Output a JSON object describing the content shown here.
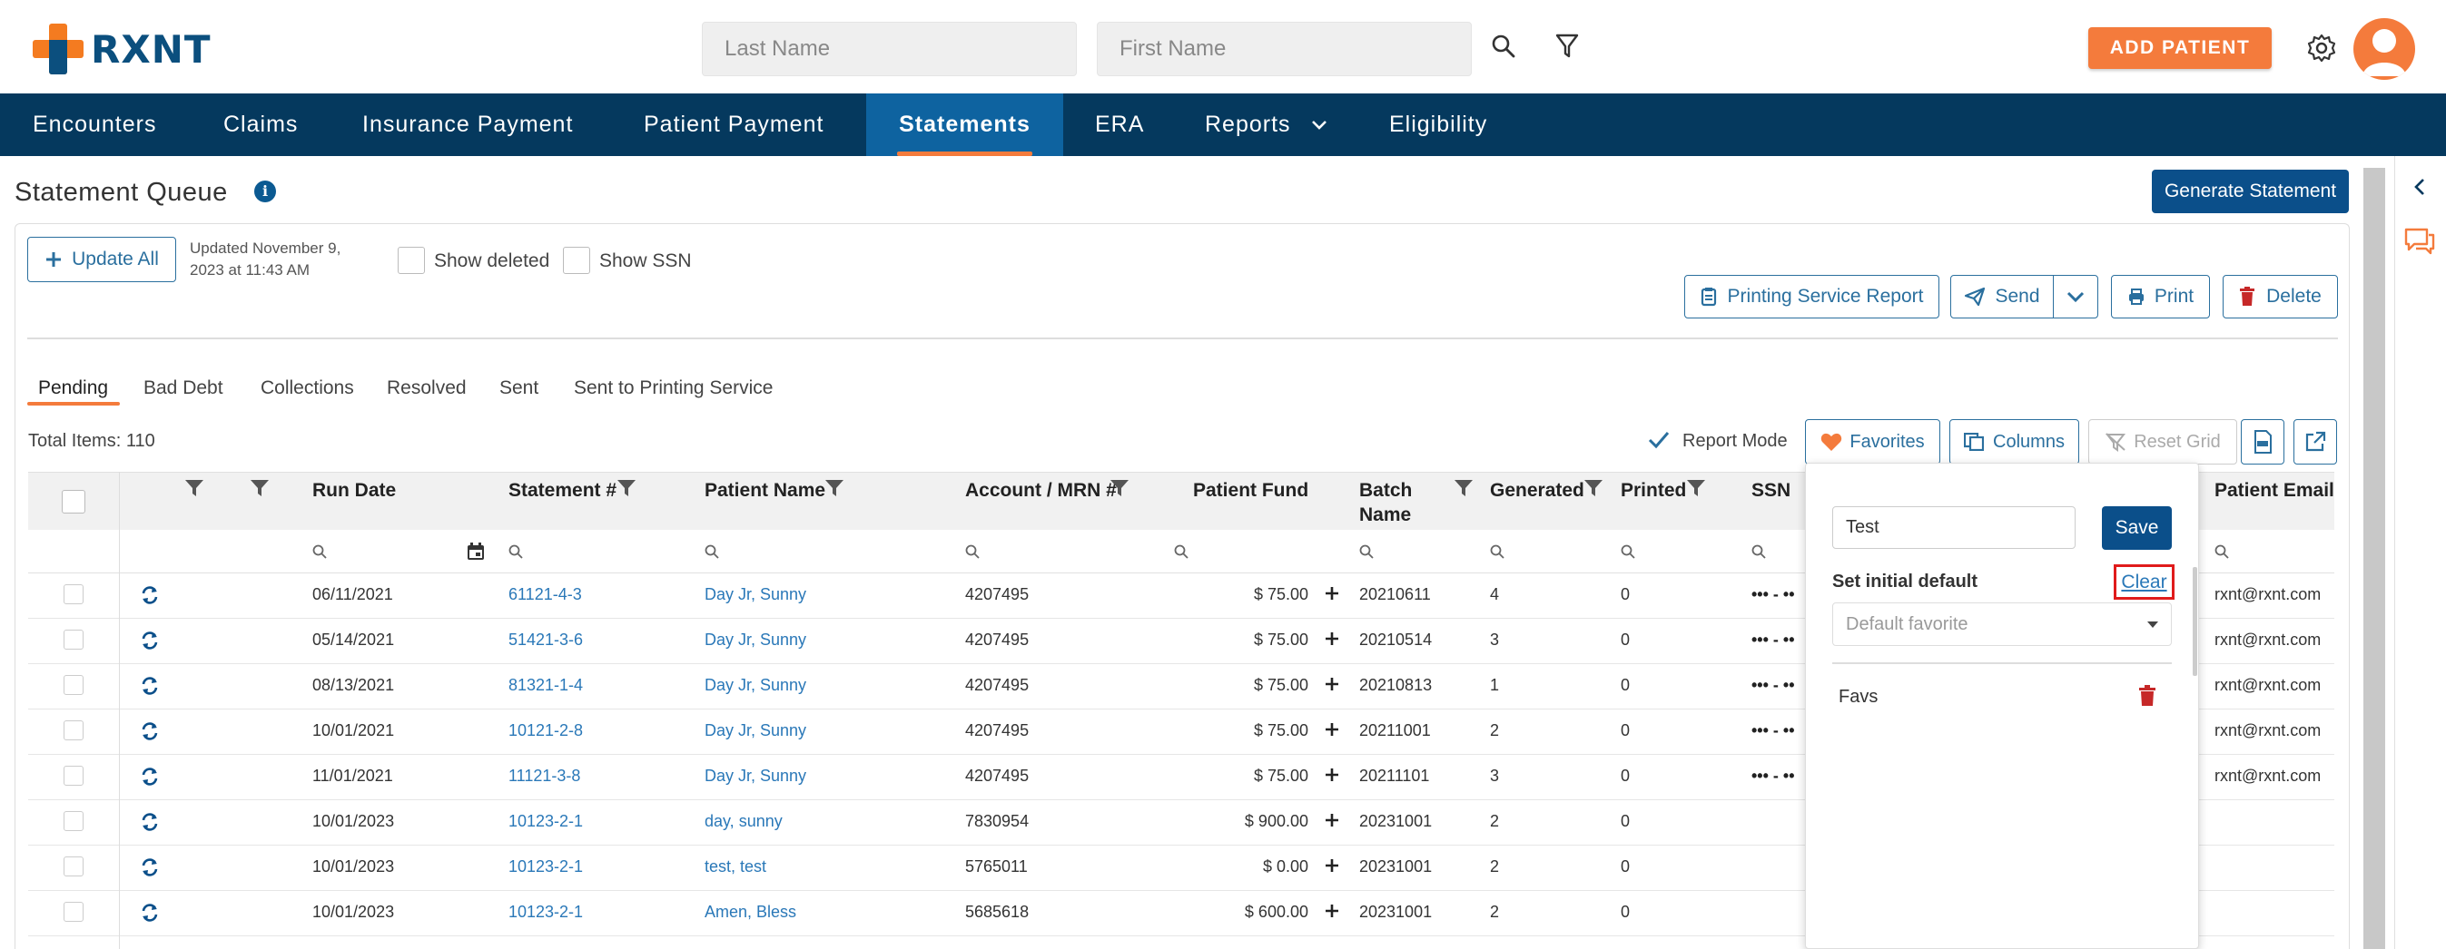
{
  "brand": {
    "name": "RXNT",
    "orange": "#f47b20",
    "navy": "#0b4f7e"
  },
  "header": {
    "last_name_placeholder": "Last Name",
    "first_name_placeholder": "First Name",
    "search_icon": "search-icon",
    "filter_icon": "filter-icon",
    "add_patient_label": "ADD PATIENT",
    "settings_icon": "gear-icon"
  },
  "nav": {
    "items": [
      "Encounters",
      "Claims",
      "Insurance Payment",
      "Patient Payment",
      "Statements",
      "ERA",
      "Reports",
      "Eligibility"
    ],
    "active": "Statements"
  },
  "page": {
    "title": "Statement Queue",
    "info_glyph": "i",
    "generate_label": "Generate Statement"
  },
  "toolbar": {
    "update_all_label": "Update All",
    "updated_line1": "Updated November 9,",
    "updated_line2": "2023 at 11:43 AM",
    "show_deleted_label": "Show deleted",
    "show_ssn_label": "Show SSN",
    "printing_service_report_label": "Printing Service Report",
    "send_label": "Send",
    "print_label": "Print",
    "delete_label": "Delete"
  },
  "tabs": [
    "Pending",
    "Bad Debt",
    "Collections",
    "Resolved",
    "Sent",
    "Sent to Printing Service"
  ],
  "grid": {
    "total_items": "Total Items: 110",
    "report_mode_label": "Report Mode",
    "favorites_label": "Favorites",
    "columns_label": "Columns",
    "reset_grid_label": "Reset Grid",
    "columns": {
      "run_date": "Run Date",
      "statement": "Statement #",
      "patient_name": "Patient Name",
      "account": "Account / MRN #",
      "patient_fund": "Patient Fund",
      "batch_name_1": "Batch",
      "batch_name_2": "Name",
      "generated": "Generated",
      "printed": "Printed",
      "ssn": "SSN",
      "patient_email": "Patient Email"
    },
    "rows": [
      {
        "run_date": "06/11/2021",
        "statement": "61121-4-3",
        "patient": "Day Jr, Sunny",
        "account": "4207495",
        "fund": "$ 75.00",
        "batch": "20210611",
        "generated": "4",
        "printed": "0",
        "ssn": "••• - ••",
        "email": "rxnt@rxnt.com"
      },
      {
        "run_date": "05/14/2021",
        "statement": "51421-3-6",
        "patient": "Day Jr, Sunny",
        "account": "4207495",
        "fund": "$ 75.00",
        "batch": "20210514",
        "generated": "3",
        "printed": "0",
        "ssn": "••• - ••",
        "email": "rxnt@rxnt.com"
      },
      {
        "run_date": "08/13/2021",
        "statement": "81321-1-4",
        "patient": "Day Jr, Sunny",
        "account": "4207495",
        "fund": "$ 75.00",
        "batch": "20210813",
        "generated": "1",
        "printed": "0",
        "ssn": "••• - ••",
        "email": "rxnt@rxnt.com"
      },
      {
        "run_date": "10/01/2021",
        "statement": "10121-2-8",
        "patient": "Day Jr, Sunny",
        "account": "4207495",
        "fund": "$ 75.00",
        "batch": "20211001",
        "generated": "2",
        "printed": "0",
        "ssn": "••• - ••",
        "email": "rxnt@rxnt.com"
      },
      {
        "run_date": "11/01/2021",
        "statement": "11121-3-8",
        "patient": "Day Jr, Sunny",
        "account": "4207495",
        "fund": "$ 75.00",
        "batch": "20211101",
        "generated": "3",
        "printed": "0",
        "ssn": "••• - ••",
        "email": "rxnt@rxnt.com"
      },
      {
        "run_date": "10/01/2023",
        "statement": "10123-2-1",
        "patient": "day, sunny",
        "account": "7830954",
        "fund": "$ 900.00",
        "batch": "20231001",
        "generated": "2",
        "printed": "0",
        "ssn": "",
        "email": ""
      },
      {
        "run_date": "10/01/2023",
        "statement": "10123-2-1",
        "patient": "test, test",
        "account": "5765011",
        "fund": "$ 0.00",
        "batch": "20231001",
        "generated": "2",
        "printed": "0",
        "ssn": "",
        "email": ""
      },
      {
        "run_date": "10/01/2023",
        "statement": "10123-2-1",
        "patient": "Amen, Bless",
        "account": "5685618",
        "fund": "$ 600.00",
        "batch": "20231001",
        "generated": "2",
        "printed": "0",
        "ssn": "",
        "email": ""
      }
    ]
  },
  "favorites_popup": {
    "name_value": "Test",
    "save_label": "Save",
    "set_default_label": "Set initial default",
    "clear_label": "Clear",
    "default_placeholder": "Default favorite",
    "favorite_item": "Favs"
  }
}
